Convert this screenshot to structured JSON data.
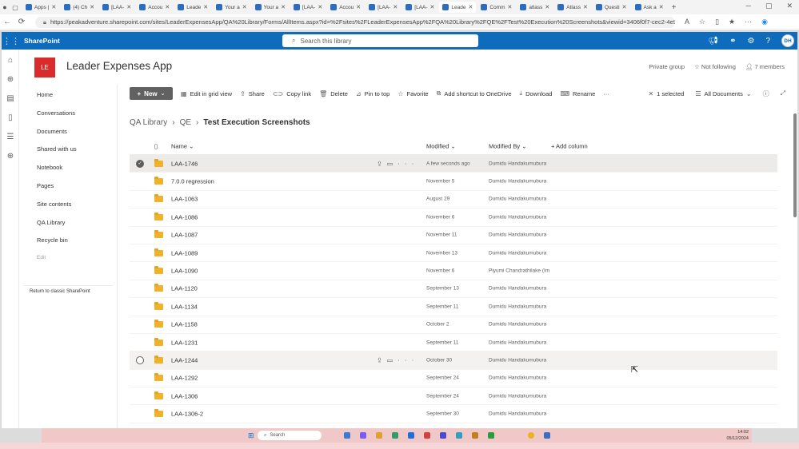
{
  "browser": {
    "tabs": [
      {
        "label": "Apps |"
      },
      {
        "label": "(4) Ch"
      },
      {
        "label": "[LAA-"
      },
      {
        "label": "Accou"
      },
      {
        "label": "Leade"
      },
      {
        "label": "Your a"
      },
      {
        "label": "Your a"
      },
      {
        "label": "[LAA-"
      },
      {
        "label": "Accou"
      },
      {
        "label": "[LAA-"
      },
      {
        "label": "[LAA-"
      },
      {
        "label": "Leade"
      },
      {
        "label": "Comm"
      },
      {
        "label": "atlass"
      },
      {
        "label": "Atlass"
      },
      {
        "label": "Questi"
      },
      {
        "label": "Ask a"
      }
    ],
    "new_tab": "+",
    "url": "https://peakadventure.sharepoint.com/sites/LeaderExpensesApp/QA%20Library/Forms/AllItems.aspx?id=%2Fsites%2FLeaderExpensesApp%2FQA%20Library%2FQE%2FTest%20Execution%20Screenshots&viewid=3406f0f7-cec2-4e99-a448-8b..."
  },
  "suite": {
    "brand": "SharePoint",
    "search_placeholder": "Search this library",
    "avatar_initials": "DH"
  },
  "site": {
    "logo_text": "LE",
    "title": "Leader Expenses App",
    "group_type": "Private group",
    "follow_label": "Not following",
    "members_label": "7 members"
  },
  "nav": {
    "items": [
      {
        "label": "Home"
      },
      {
        "label": "Conversations"
      },
      {
        "label": "Documents"
      },
      {
        "label": "Shared with us"
      },
      {
        "label": "Notebook"
      },
      {
        "label": "Pages"
      },
      {
        "label": "Site contents"
      },
      {
        "label": "QA Library"
      },
      {
        "label": "Recycle bin"
      }
    ],
    "edit_label": "Edit",
    "return_classic": "Return to classic SharePoint"
  },
  "commands": {
    "new_label": "New",
    "edit_grid": "Edit in grid view",
    "share": "Share",
    "copy_link": "Copy link",
    "delete": "Delete",
    "pin_to_top": "Pin to top",
    "favorite": "Favorite",
    "add_shortcut": "Add shortcut to OneDrive",
    "download": "Download",
    "rename": "Rename",
    "more": "···",
    "selected_count": "1 selected",
    "view_label": "All Documents"
  },
  "breadcrumb": {
    "root": "QA Library",
    "mid": "QE",
    "current": "Test Execution Screenshots"
  },
  "table": {
    "columns": {
      "name": "Name",
      "modified": "Modified",
      "modified_by": "Modified By",
      "add_column": "+ Add column"
    },
    "rows": [
      {
        "name": "LAA-1746",
        "modified": "A few seconds ago",
        "modified_by": "Dumidu Handakumubura",
        "state": "selected"
      },
      {
        "name": "7.0.0 regression",
        "modified": "November 5",
        "modified_by": "Dumidu Handakumubura"
      },
      {
        "name": "LAA-1063",
        "modified": "August 29",
        "modified_by": "Dumidu Handakumubura"
      },
      {
        "name": "LAA-1086",
        "modified": "November 6",
        "modified_by": "Dumidu Handakumubura"
      },
      {
        "name": "LAA-1087",
        "modified": "November 11",
        "modified_by": "Dumidu Handakumubura"
      },
      {
        "name": "LAA-1089",
        "modified": "November 13",
        "modified_by": "Dumidu Handakumubura"
      },
      {
        "name": "LAA-1090",
        "modified": "November 6",
        "modified_by": "Piyumi Chandrathilake (Im"
      },
      {
        "name": "LAA-1120",
        "modified": "September 13",
        "modified_by": "Dumidu Handakumubura"
      },
      {
        "name": "LAA-1134",
        "modified": "September 11",
        "modified_by": "Dumidu Handakumubura"
      },
      {
        "name": "LAA-1158",
        "modified": "October 2",
        "modified_by": "Dumidu Handakumubura"
      },
      {
        "name": "LAA-1231",
        "modified": "September 11",
        "modified_by": "Dumidu Handakumubura"
      },
      {
        "name": "LAA-1244",
        "modified": "October 30",
        "modified_by": "Dumidu Handakumubura",
        "state": "hovered"
      },
      {
        "name": "LAA-1292",
        "modified": "September 24",
        "modified_by": "Dumidu Handakumubura"
      },
      {
        "name": "LAA-1306",
        "modified": "September 24",
        "modified_by": "Dumidu Handakumubura"
      },
      {
        "name": "LAA-1306-2",
        "modified": "September 30",
        "modified_by": "Dumidu Handakumubura"
      }
    ]
  },
  "taskbar": {
    "search_label": "Search",
    "time": "14:02",
    "date": "05/12/2024"
  },
  "colors": {
    "suite_blue": "#0f6cbd",
    "logo_red": "#d92b2b",
    "folder_yellow": "#f0b12b"
  }
}
